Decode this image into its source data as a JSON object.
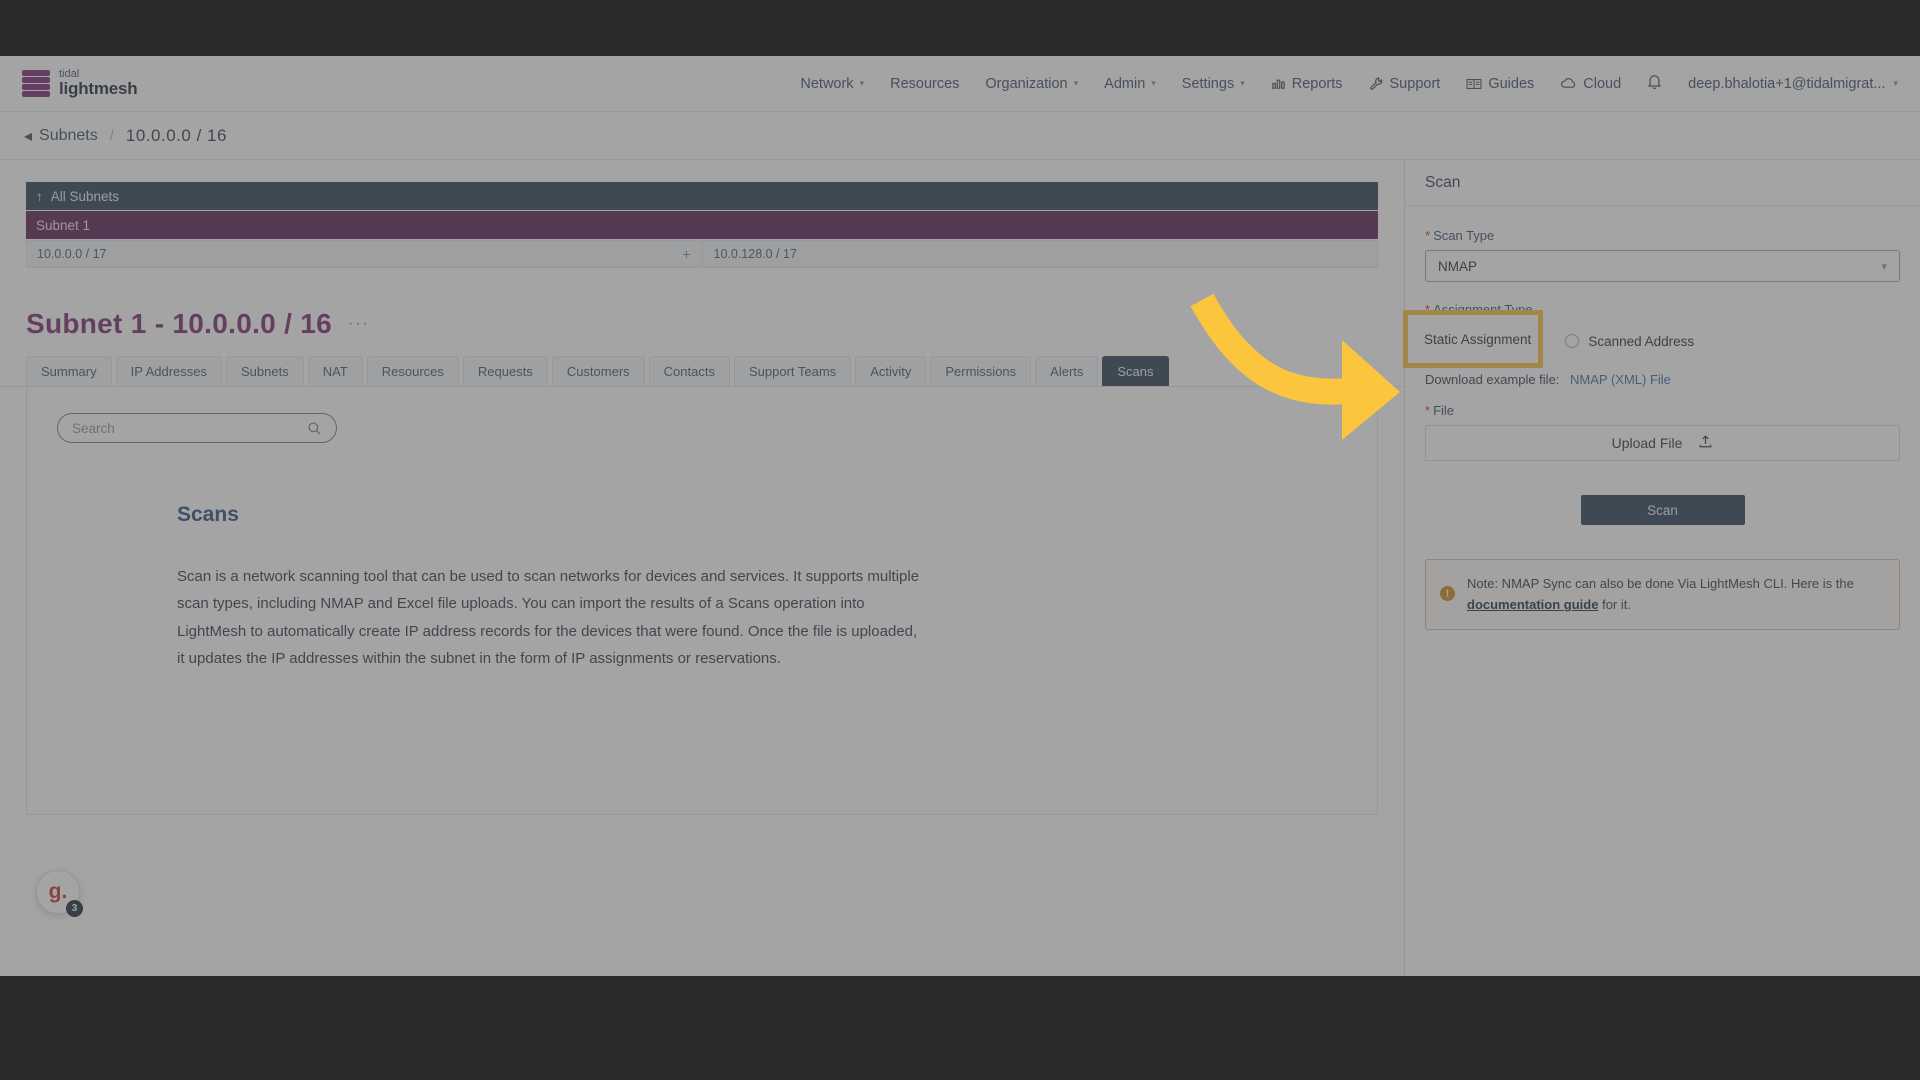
{
  "brand": {
    "line1": "tidal",
    "line2": "lightmesh"
  },
  "topnav": {
    "items": [
      {
        "label": "Network",
        "caret": true,
        "icon": null
      },
      {
        "label": "Resources",
        "caret": false,
        "icon": null
      },
      {
        "label": "Organization",
        "caret": true,
        "icon": null
      },
      {
        "label": "Admin",
        "caret": true,
        "icon": null
      },
      {
        "label": "Settings",
        "caret": true,
        "icon": null
      },
      {
        "label": "Reports",
        "caret": false,
        "icon": "chart-bar-icon"
      },
      {
        "label": "Support",
        "caret": false,
        "icon": "wrench-icon"
      },
      {
        "label": "Guides",
        "caret": false,
        "icon": "book-icon"
      },
      {
        "label": "Cloud",
        "caret": false,
        "icon": "cloud-icon"
      }
    ],
    "notifications_icon": "bell-icon",
    "user": "deep.bhalotia+1@tidalmigrat...",
    "user_caret": "⌄"
  },
  "breadcrumb": {
    "back_label": "Subnets",
    "separator": "/",
    "current": "10.0.0.0 / 16"
  },
  "subnet_bars": {
    "all_subnets": {
      "label": "All Subnets",
      "icon": "arrow-up-icon"
    },
    "subnet_row": {
      "label": "Subnet 1"
    },
    "segments": [
      {
        "label": "10.0.0.0 / 17",
        "plus": "+"
      },
      {
        "label": "10.0.128.0 / 17",
        "plus": ""
      }
    ]
  },
  "page": {
    "title": "Subnet 1 - 10.0.0.0 / 16",
    "more_label": "···"
  },
  "tabs": [
    {
      "label": "Summary",
      "active": false
    },
    {
      "label": "IP Addresses",
      "active": false
    },
    {
      "label": "Subnets",
      "active": false
    },
    {
      "label": "NAT",
      "active": false
    },
    {
      "label": "Resources",
      "active": false
    },
    {
      "label": "Requests",
      "active": false
    },
    {
      "label": "Customers",
      "active": false
    },
    {
      "label": "Contacts",
      "active": false
    },
    {
      "label": "Support Teams",
      "active": false
    },
    {
      "label": "Activity",
      "active": false
    },
    {
      "label": "Permissions",
      "active": false
    },
    {
      "label": "Alerts",
      "active": false
    },
    {
      "label": "Scans",
      "active": true
    }
  ],
  "search": {
    "value": "",
    "placeholder": "Search",
    "icon": "search-icon"
  },
  "content": {
    "heading": "Scans",
    "paragraph": "Scan is a network scanning tool that can be used to scan networks for devices and services. It supports multiple scan types, including NMAP and Excel file uploads. You can import the results of a Scans operation into LightMesh to automatically create IP address records for the devices that were found. Once the file is uploaded, it updates the IP addresses within the subnet in the form of IP assignments or reservations."
  },
  "fab": {
    "letter": "g.",
    "badge": "3"
  },
  "panel": {
    "title": "Scan",
    "scan_type": {
      "label": "Scan Type",
      "required": "*",
      "value": "NMAP"
    },
    "assignment_type": {
      "label": "Assignment Type",
      "required": "*",
      "options": [
        {
          "label": "Static Assignment",
          "selected": false,
          "highlighted": true
        },
        {
          "label": "Scanned Address",
          "selected": false,
          "highlighted": false
        }
      ]
    },
    "download": {
      "prefix": "Download example file:",
      "link": "NMAP (XML) File"
    },
    "file": {
      "label": "File",
      "required": "*",
      "upload_label": "Upload File",
      "upload_icon": "upload-icon"
    },
    "submit": {
      "label": "Scan"
    },
    "note": {
      "icon": "info-icon",
      "text_before": "Note: NMAP Sync can also be done Via LightMesh CLI. Here is the",
      "link": "documentation guide",
      "text_after": "for it."
    }
  },
  "annotation": {
    "type": "arrow",
    "color": "#fbc53d",
    "highlight_color": "#fbc53d"
  }
}
